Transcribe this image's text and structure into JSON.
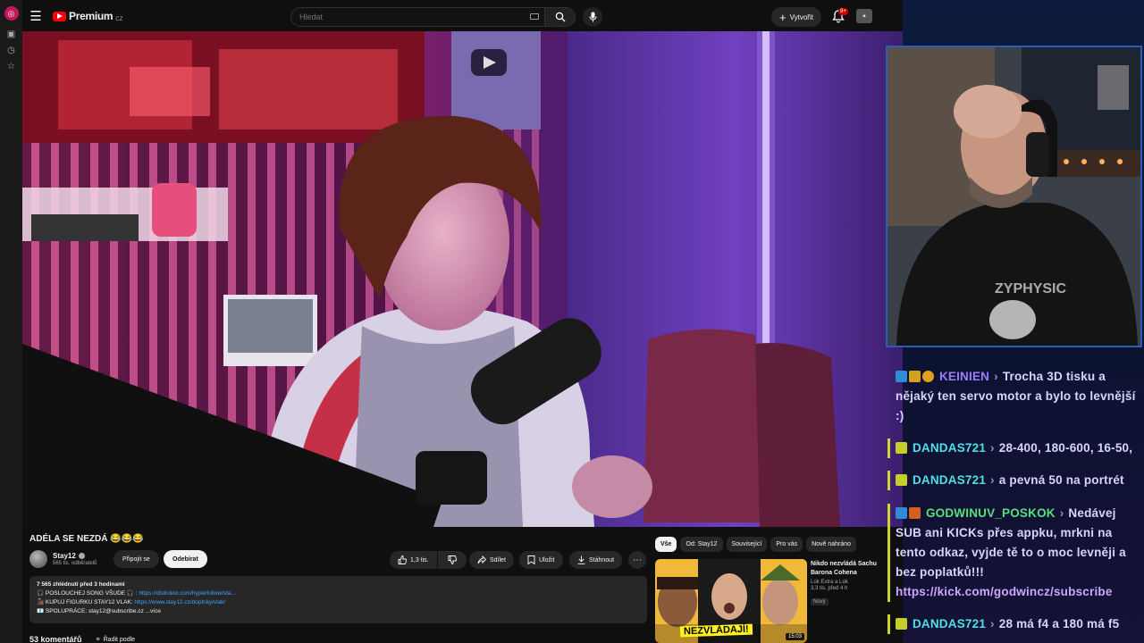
{
  "header": {
    "logo_text": "Premium",
    "logo_region": "CZ",
    "search_placeholder": "Hledat",
    "create_label": "Vytvořit",
    "notification_count": "9+"
  },
  "video": {
    "title": "ADÉLA SE NEZDÁ 😂😂😂",
    "channel_name": "Stay12",
    "subscribers": "565 tis. odběratelů",
    "join_label": "Připojit se",
    "subscribe_label": "Odebírat",
    "likes": "1,3 tis.",
    "share_label": "Sdílet",
    "save_label": "Uložit",
    "download_label": "Stáhnout"
  },
  "description": {
    "stats": "7 565 zhlédnutí  před 3 hodinami",
    "line1_label": "🎧 POSLOUCHEJ SONG VŠUDE 🎧 : ",
    "line1_link": "https://distrokid.com/hyperfollow/sta...",
    "line2_label": "🚂 KUPUJ FIGURKU STAY12 VLAK: ",
    "line2_link": "https://www.stay12.cz/doplnky/vlak/",
    "line3_label": "📧 SPOLUPRÁCE: stay12@subscribe.cz",
    "more_label": "...více"
  },
  "comments": {
    "count_label": "53 komentářů",
    "sort_label": "Řadit podle"
  },
  "recommendations": {
    "chips": [
      "Vše",
      "Od: Stay12",
      "Související",
      "Pro vás",
      "Nově nahráno"
    ],
    "active_chip": "Vše",
    "first": {
      "title": "Nikdo nezvládá Sachu Barona Cohena",
      "channel": "Lúk Extra a Lúk",
      "meta": "3,3 tis.  před 4 h",
      "badge": "Nový",
      "duration": "15:03",
      "thumb_caption": "NEZVLÁDAJÍ!"
    }
  },
  "chat": [
    {
      "user": "KEINIEN",
      "text": "Trocha 3D tisku a nějaký ten servo motor a bylo to levnější :)",
      "user_color": "#9b7bff"
    },
    {
      "user": "DANDAS721",
      "text": "28-400, 180-600, 16-50,",
      "user_color": "#4fe0e6"
    },
    {
      "user": "DANDAS721",
      "text": "a pevná 50 na portrét",
      "user_color": "#4fe0e6"
    },
    {
      "user": "GODWINUV_POSKOK",
      "text": "Nedávej SUB ani KICKs přes appku, mrkni na tento odkaz, vyjde tě to o moc levněji a bez poplatků!!!",
      "link": "https://kick.com/godwincz/subscribe",
      "user_color": "#58e07a"
    },
    {
      "user": "DANDAS721",
      "text": "28 má f4 a 180 má f5",
      "user_color": "#4fe0e6"
    }
  ],
  "colors": {
    "youtube_red": "#ff0000",
    "link_blue": "#3ea6ff",
    "chat_bar": "#cfd631",
    "cam_border": "#2a5db8"
  }
}
